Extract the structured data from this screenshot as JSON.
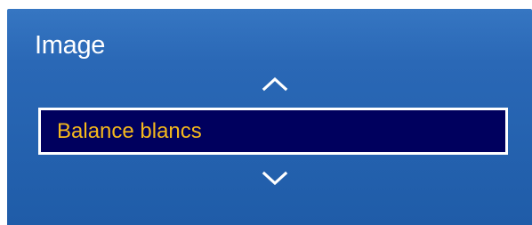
{
  "menu": {
    "title": "Image",
    "selected_item": {
      "label": "Balance blancs"
    },
    "icons": {
      "up": "chevron-up-icon",
      "down": "chevron-down-icon"
    }
  },
  "colors": {
    "panel_background": "#2a68b6",
    "selected_background": "#00005e",
    "selected_border": "#ffffff",
    "selected_text": "#f5b81c",
    "title_text": "#ffffff"
  }
}
